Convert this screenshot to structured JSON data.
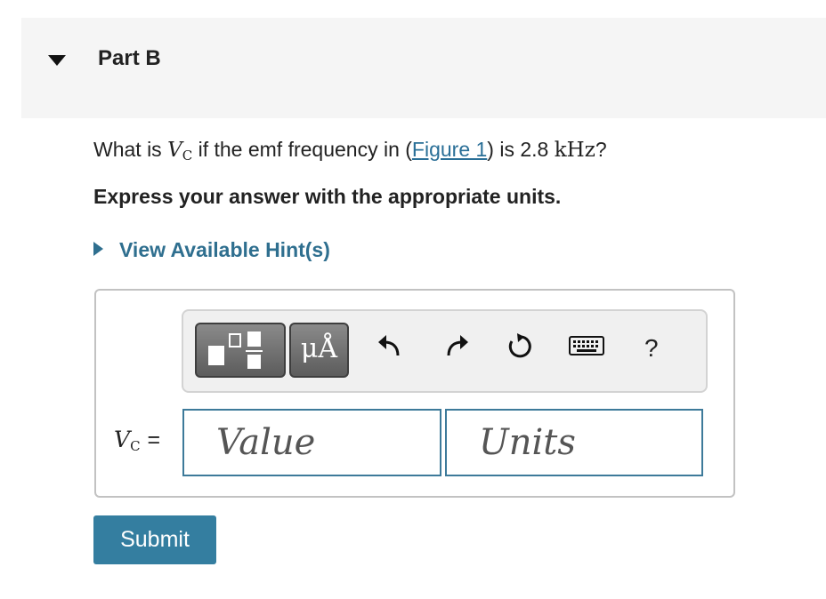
{
  "part": {
    "title": "Part B"
  },
  "question": {
    "prefix": "What is",
    "var_main": "V",
    "var_sub": "C",
    "middle": "if the emf frequency in (",
    "link_text": "Figure 1",
    "after_link": ") is 2.8",
    "unit": "kHz",
    "suffix": "?"
  },
  "instruction": "Express your answer with the appropriate units.",
  "hint": {
    "label": "View Available Hint(s)"
  },
  "toolbar": {
    "units_label": "μÅ",
    "help_label": "?"
  },
  "answer": {
    "label_main": "V",
    "label_sub": "C",
    "equals": "=",
    "value_placeholder": "Value",
    "units_placeholder": "Units"
  },
  "submit_label": "Submit",
  "colors": {
    "accent": "#347ea0",
    "link": "#2a6f97",
    "header_bg": "#f5f5f5"
  }
}
